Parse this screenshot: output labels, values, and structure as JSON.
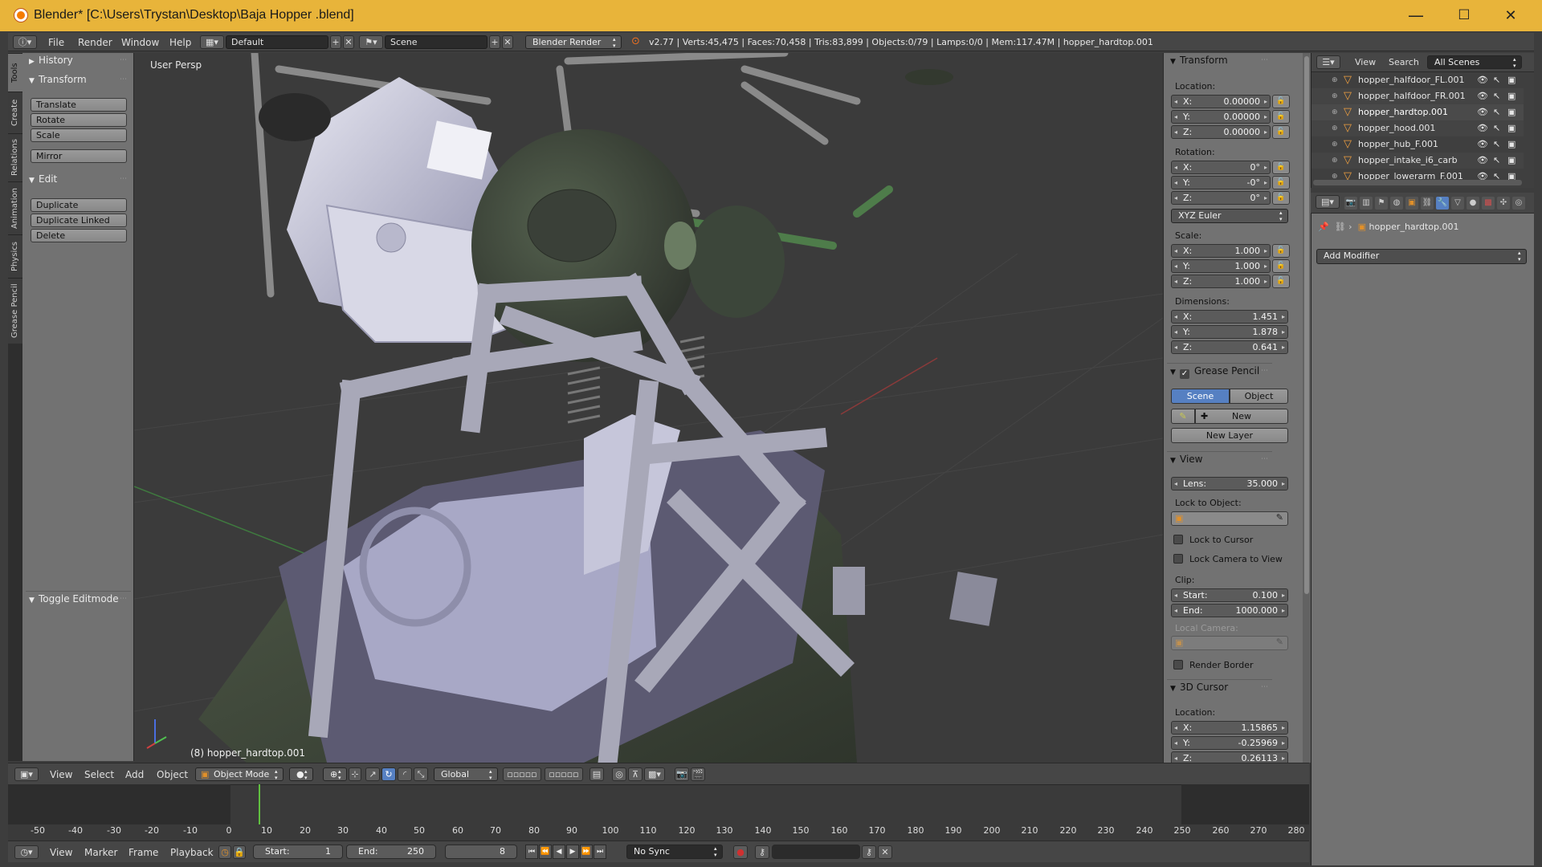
{
  "window": {
    "title": "Blender* [C:\\Users\\Trystan\\Desktop\\Baja Hopper .blend]",
    "minimize": "—",
    "maximize": "☐",
    "close": "✕",
    "icon": "blender-logo-icon"
  },
  "infobar": {
    "menus": [
      "File",
      "Render",
      "Window",
      "Help"
    ],
    "layout": "Default",
    "scene": "Scene",
    "engine": "Blender Render",
    "stats": "v2.77 | Verts:45,475 | Faces:70,458 | Tris:83,899 | Objects:0/79 | Lamps:0/0 | Mem:117.47M | hopper_hardtop.001"
  },
  "tabs": [
    "Tools",
    "Create",
    "Relations",
    "Animation",
    "Physics",
    "Grease Pencil"
  ],
  "toolshelf": {
    "history": "History",
    "transform": "Transform",
    "transform_buttons": [
      "Translate",
      "Rotate",
      "Scale",
      "Mirror"
    ],
    "edit": "Edit",
    "edit_buttons": [
      "Duplicate",
      "Duplicate Linked",
      "Delete"
    ],
    "toggle": "Toggle Editmode"
  },
  "viewport": {
    "label": "User Persp",
    "object": "(8) hopper_hardtop.001"
  },
  "npanel": {
    "transform_title": "Transform",
    "location_label": "Location:",
    "location": [
      {
        "k": "X:",
        "v": "0.00000"
      },
      {
        "k": "Y:",
        "v": "0.00000"
      },
      {
        "k": "Z:",
        "v": "0.00000"
      }
    ],
    "rotation_label": "Rotation:",
    "rotation": [
      {
        "k": "X:",
        "v": "0°"
      },
      {
        "k": "Y:",
        "v": "-0°"
      },
      {
        "k": "Z:",
        "v": "0°"
      }
    ],
    "rotation_mode": "XYZ Euler",
    "scale_label": "Scale:",
    "scale": [
      {
        "k": "X:",
        "v": "1.000"
      },
      {
        "k": "Y:",
        "v": "1.000"
      },
      {
        "k": "Z:",
        "v": "1.000"
      }
    ],
    "dimensions_label": "Dimensions:",
    "dimensions": [
      {
        "k": "X:",
        "v": "1.451"
      },
      {
        "k": "Y:",
        "v": "1.878"
      },
      {
        "k": "Z:",
        "v": "0.641"
      }
    ],
    "grease_title": "Grease Pencil",
    "grease_scene": "Scene",
    "grease_object": "Object",
    "grease_new": "New",
    "grease_new_layer": "New Layer",
    "view_title": "View",
    "lens_k": "Lens:",
    "lens_v": "35.000",
    "lock_object_label": "Lock to Object:",
    "lock_cursor": "Lock to Cursor",
    "lock_camera": "Lock Camera to View",
    "clip_label": "Clip:",
    "clip_start_k": "Start:",
    "clip_start_v": "0.100",
    "clip_end_k": "End:",
    "clip_end_v": "1000.000",
    "local_camera_label": "Local Camera:",
    "render_border": "Render Border",
    "cursor_title": "3D Cursor",
    "cursor_location_label": "Location:",
    "cursor": [
      {
        "k": "X:",
        "v": "1.15865"
      },
      {
        "k": "Y:",
        "v": "-0.25969"
      },
      {
        "k": "Z:",
        "v": "0.26113"
      }
    ]
  },
  "outliner": {
    "view": "View",
    "search": "Search",
    "filter": "All Scenes",
    "items": [
      "hopper_halfdoor_FL.001",
      "hopper_halfdoor_FR.001",
      "hopper_hardtop.001",
      "hopper_hood.001",
      "hopper_hub_F.001",
      "hopper_intake_i6_carb",
      "hopper_lowerarm_F.001"
    ]
  },
  "properties": {
    "breadcrumb": "hopper_hardtop.001",
    "add_modifier": "Add Modifier"
  },
  "vpheader": {
    "menus": [
      "View",
      "Select",
      "Add",
      "Object"
    ],
    "mode": "Object Mode",
    "orientation": "Global"
  },
  "timeline": {
    "ticks": [
      "-50",
      "-40",
      "-30",
      "-20",
      "-10",
      "0",
      "10",
      "20",
      "30",
      "40",
      "50",
      "60",
      "70",
      "80",
      "90",
      "100",
      "110",
      "120",
      "130",
      "140",
      "150",
      "160",
      "170",
      "180",
      "190",
      "200",
      "210",
      "220",
      "230",
      "240",
      "250",
      "260",
      "270",
      "280"
    ],
    "menus": [
      "View",
      "Marker",
      "Frame",
      "Playback"
    ],
    "start_k": "Start:",
    "start_v": "1",
    "end_k": "End:",
    "end_v": "250",
    "current": "8",
    "sync": "No Sync"
  },
  "colors": {
    "titlebar": "#e8b43a",
    "accent": "#5680c2",
    "current_frame": "#60c040"
  }
}
